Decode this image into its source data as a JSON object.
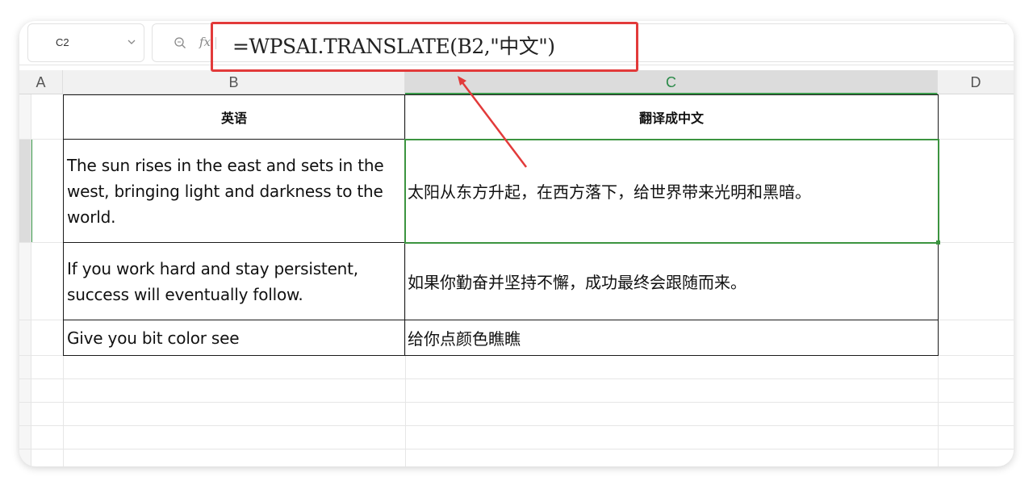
{
  "formula_bar": {
    "cell_ref": "C2",
    "fx_label": "fx",
    "formula": "=WPSAI.TRANSLATE(B2,\"中文\")"
  },
  "columns": [
    "A",
    "B",
    "C",
    "D"
  ],
  "active_column": "C",
  "table": {
    "headers": {
      "b": "英语",
      "c": "翻译成中文"
    },
    "rows": [
      {
        "en": "The sun rises in the east and sets in the west, bringing light and darkness to the world.",
        "zh": "太阳从东方升起，在西方落下，给世界带来光明和黑暗。"
      },
      {
        "en": "If you work hard and stay persistent, success will eventually follow.",
        "zh": "如果你勤奋并坚持不懈，成功最终会跟随而来。"
      },
      {
        "en": "Give you bit color see",
        "zh": "给你点颜色瞧瞧"
      }
    ]
  },
  "colors": {
    "selection": "#3c9440",
    "annotation": "#e23a3a",
    "active_header": "#2a8a48"
  }
}
